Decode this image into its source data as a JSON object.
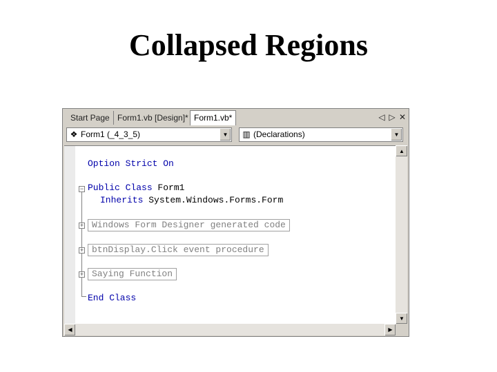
{
  "slide": {
    "title": "Collapsed Regions"
  },
  "tabs": [
    {
      "label": "Start Page",
      "active": false
    },
    {
      "label": "Form1.vb [Design]*",
      "active": false
    },
    {
      "label": "Form1.vb*",
      "active": true
    }
  ],
  "tab_controls": {
    "prev": "◁",
    "next": "▷",
    "close": "✕"
  },
  "dropdowns": {
    "class_name": "Form1 (_4_3_5)",
    "method_name": "(Declarations)",
    "arrow": "▼"
  },
  "code": {
    "option": {
      "kw": "Option Strict On"
    },
    "class_decl": {
      "kw": "Public Class",
      "name": " Form1"
    },
    "inherits": {
      "kw": "Inherits",
      "rest": " System.Windows.Forms.Form"
    },
    "regions": [
      "Windows Form Designer generated code",
      "btnDisplay.Click event procedure",
      "Saying Function"
    ],
    "end_class": "End Class"
  },
  "outline": {
    "expanded": "−",
    "collapsed": "+"
  },
  "scroll": {
    "up": "▲",
    "down": "▼",
    "left": "◀",
    "right": "▶"
  },
  "colors": {
    "keyword": "#0000aa",
    "region_text": "#808080",
    "chrome": "#d4d0c8"
  }
}
